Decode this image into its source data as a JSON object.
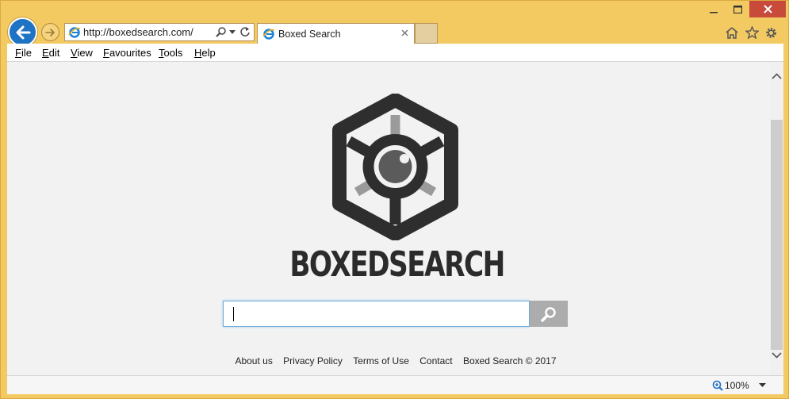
{
  "browser": {
    "url": "http://boxedsearch.com/",
    "tab_title": "Boxed Search",
    "zoom": "100%"
  },
  "menu": {
    "items": [
      {
        "underline": "F",
        "rest": "ile"
      },
      {
        "underline": "E",
        "rest": "dit"
      },
      {
        "underline": "V",
        "rest": "iew"
      },
      {
        "underline": "F",
        "rest": "avourites"
      },
      {
        "underline": "T",
        "rest": "ools"
      },
      {
        "underline": "H",
        "rest": "elp"
      }
    ]
  },
  "page": {
    "brand": "BOXEDSEARCH",
    "search_value": "",
    "footer_links": [
      "About us",
      "Privacy Policy",
      "Terms of Use",
      "Contact",
      "Boxed Search © 2017"
    ]
  },
  "icons": {
    "back": "back-arrow-icon",
    "forward": "forward-arrow-icon",
    "home": "home-icon",
    "favorites": "star-icon",
    "settings": "gear-icon",
    "search": "magnifier-icon"
  },
  "colors": {
    "frame": "#f3c962",
    "back_button": "#1e73c4",
    "close_button": "#c74a3a",
    "logo_dark": "#2e2e2e",
    "logo_spokes": "#9a9a9a",
    "search_button": "#acacac"
  }
}
